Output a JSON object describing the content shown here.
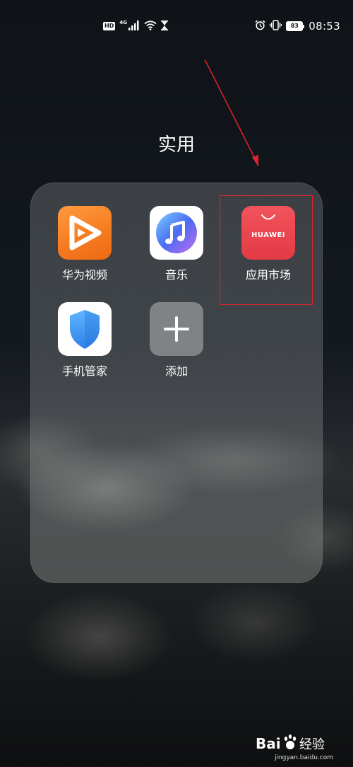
{
  "status_bar": {
    "hd_label": "HD",
    "network_type": "4G",
    "battery_level": "83",
    "time": "08:53"
  },
  "folder": {
    "title": "实用",
    "apps": [
      {
        "label": "华为视频",
        "icon": "huawei-video-icon",
        "color": "#f57a1f"
      },
      {
        "label": "音乐",
        "icon": "music-icon",
        "color": "#4a6cf2"
      },
      {
        "label": "应用市场",
        "icon": "app-market-icon",
        "color": "#e43a45",
        "icon_text": "HUAWEI"
      },
      {
        "label": "手机管家",
        "icon": "phone-manager-icon",
        "color": "#3f8df0"
      },
      {
        "label": "添加",
        "icon": "add-icon",
        "color": "#96989a"
      }
    ]
  },
  "annotation": {
    "color": "#e0232a"
  },
  "watermark": {
    "brand": "Bai经验",
    "url": "jingyan.baidu.com"
  }
}
